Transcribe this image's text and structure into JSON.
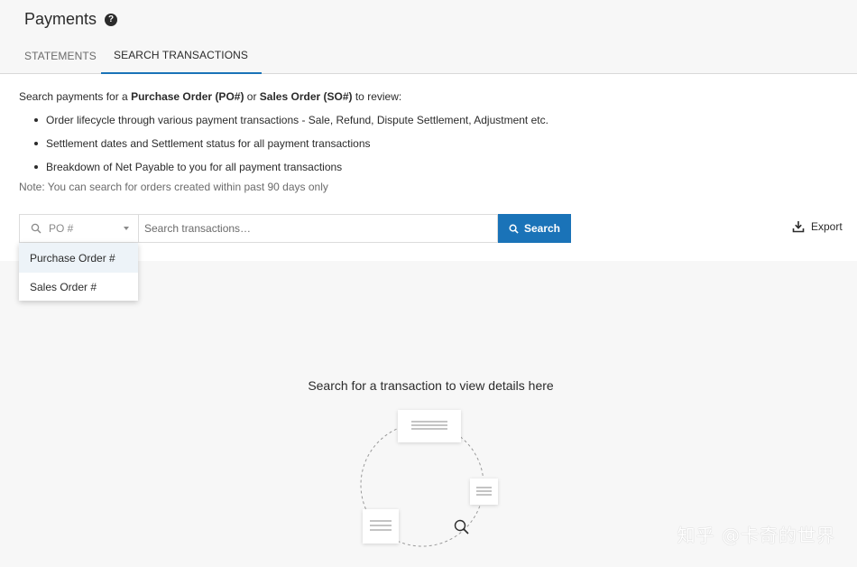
{
  "header": {
    "title": "Payments",
    "help_symbol": "?"
  },
  "tabs": [
    {
      "label": "STATEMENTS",
      "active": false
    },
    {
      "label": "SEARCH TRANSACTIONS",
      "active": true
    }
  ],
  "intro": {
    "text_prefix": "Search payments for a ",
    "po_bold": "Purchase Order (PO#)",
    "text_or": " or ",
    "so_bold": "Sales Order (SO#)",
    "text_suffix": " to review:",
    "bullets": [
      "Order lifecycle through various payment transactions - Sale, Refund, Dispute Settlement, Adjustment etc.",
      "Settlement dates and Settlement status for all payment transactions",
      "Breakdown of Net Payable to you for all payment transactions"
    ],
    "note": "Note: You can search for orders created within past 90 days only"
  },
  "search": {
    "type_selected": "PO #",
    "placeholder": "Search transactions…",
    "button_label": "Search",
    "options": [
      "Purchase Order #",
      "Sales Order #"
    ]
  },
  "export_label": "Export",
  "empty_state": {
    "message": "Search for a transaction to view details here"
  },
  "watermark": "知乎 @卡奇的世界",
  "colors": {
    "accent": "#1a73b8",
    "header_bg": "#f7f7f7",
    "dropdown_active": "#edf3f8"
  }
}
